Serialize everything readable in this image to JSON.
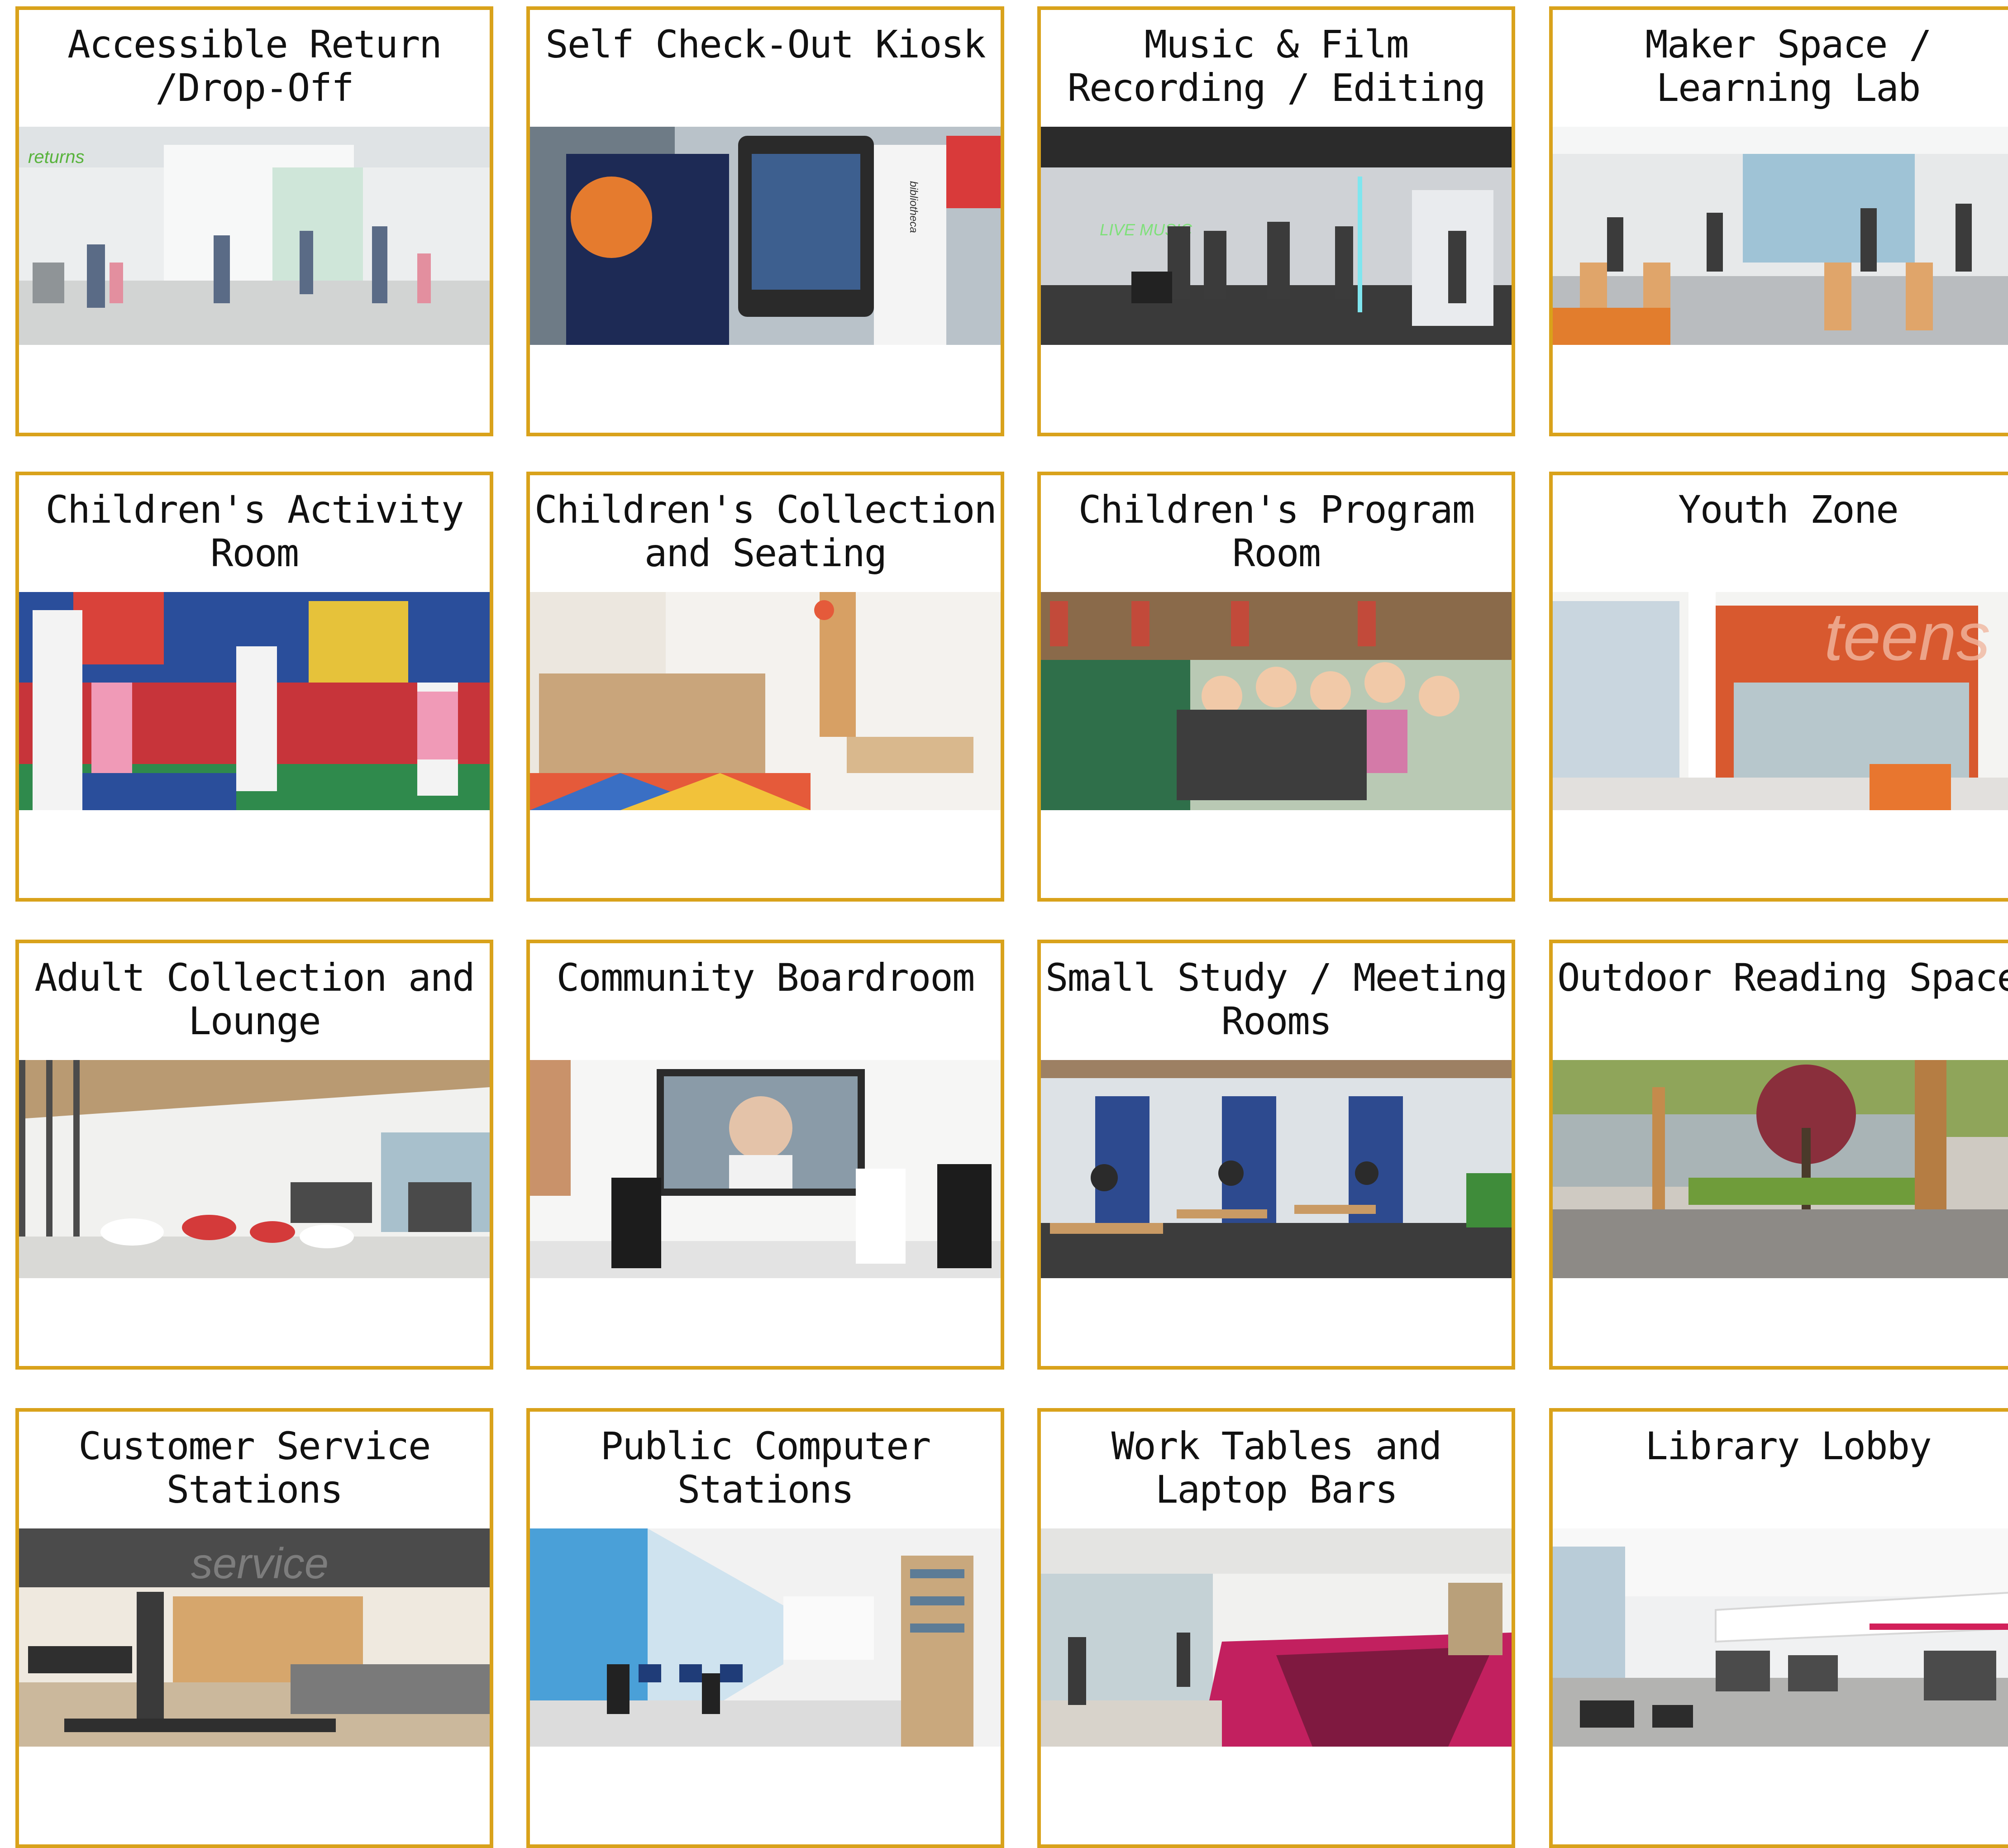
{
  "accent_color": "#d9a21b",
  "cards": [
    {
      "title": "Accessible Return\n/Drop-Off",
      "scene": "lobby-returns",
      "image_text": "returns"
    },
    {
      "title": "Self Check-Out Kiosk",
      "scene": "kiosk",
      "image_text": "bibliotheca"
    },
    {
      "title": "Music & Film Recording / Editing",
      "scene": "music-studio",
      "image_text": "LIVE MUSIC"
    },
    {
      "title": "Maker Space / Learning Lab",
      "scene": "maker-lab",
      "image_text": ""
    },
    {
      "title": "Children's Activity Room",
      "scene": "kids-blocks",
      "image_text": ""
    },
    {
      "title": "Children's Collection and Seating",
      "scene": "kids-library",
      "image_text": ""
    },
    {
      "title": "Children's Program Room",
      "scene": "storytime",
      "image_text": ""
    },
    {
      "title": "Youth Zone",
      "scene": "teens",
      "image_text": "teens"
    },
    {
      "title": "Adult Collection and Lounge",
      "scene": "lounge",
      "image_text": ""
    },
    {
      "title": "Community Boardroom",
      "scene": "boardroom",
      "image_text": ""
    },
    {
      "title": "Small Study / Meeting Rooms",
      "scene": "study-rooms",
      "image_text": ""
    },
    {
      "title": "Outdoor Reading Space",
      "scene": "courtyard",
      "image_text": ""
    },
    {
      "title": "Customer Service Stations",
      "scene": "service-desk",
      "image_text": "service"
    },
    {
      "title": "Public Computer Stations",
      "scene": "computers",
      "image_text": ""
    },
    {
      "title": "Work Tables and Laptop Bars",
      "scene": "atrium-bars",
      "image_text": ""
    },
    {
      "title": "Library Lobby",
      "scene": "lobby",
      "image_text": ""
    }
  ]
}
